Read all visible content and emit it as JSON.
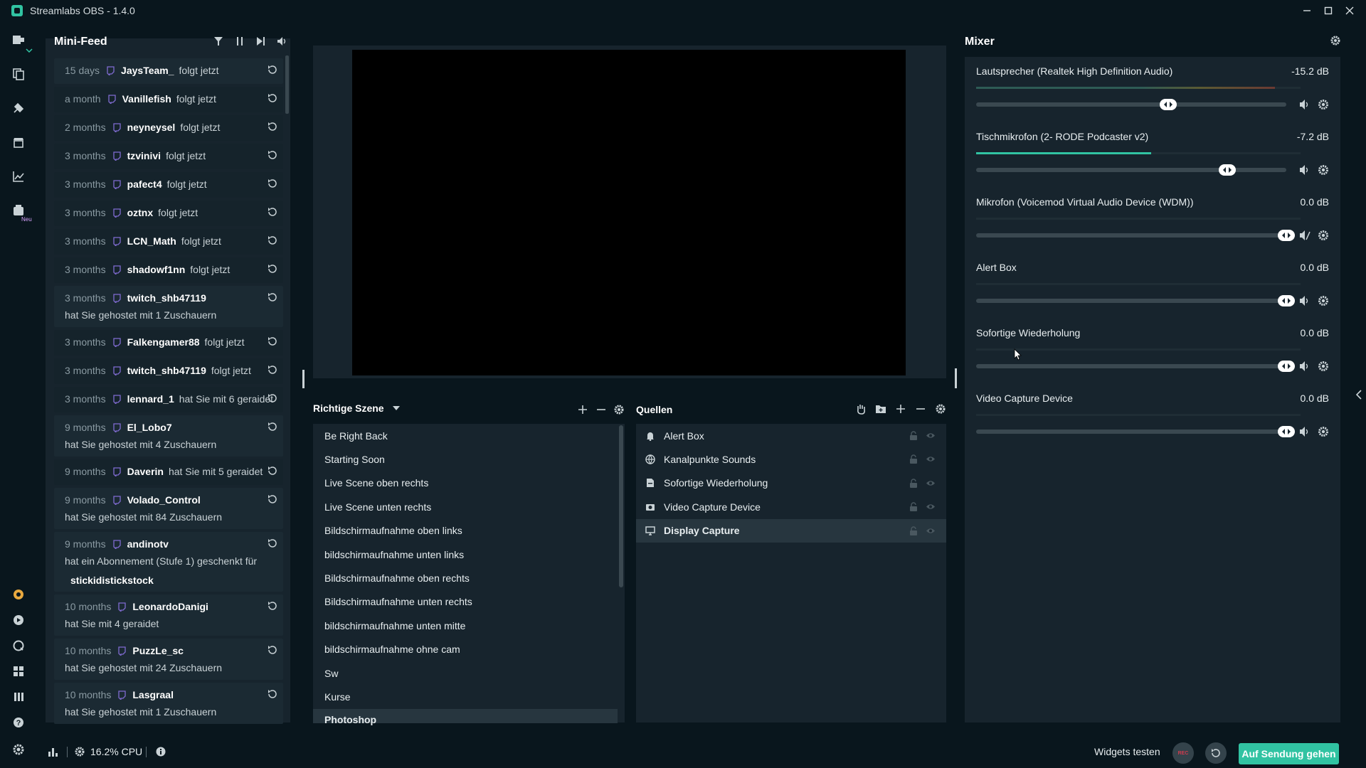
{
  "titlebar": {
    "title": "Streamlabs OBS - 1.4.0"
  },
  "leftnav": {
    "badge": "Neu"
  },
  "minifeed": {
    "title": "Mini-Feed",
    "items": [
      {
        "time": "15 days",
        "user": "JaysTeam_",
        "action": "folgt jetzt",
        "sub": "",
        "sub2": ""
      },
      {
        "time": "a month",
        "user": "Vanillefish",
        "action": "folgt jetzt",
        "sub": "",
        "sub2": ""
      },
      {
        "time": "2 months",
        "user": "neyneysel",
        "action": "folgt jetzt",
        "sub": "",
        "sub2": ""
      },
      {
        "time": "3 months",
        "user": "tzvinivi",
        "action": "folgt jetzt",
        "sub": "",
        "sub2": ""
      },
      {
        "time": "3 months",
        "user": "pafect4",
        "action": "folgt jetzt",
        "sub": "",
        "sub2": ""
      },
      {
        "time": "3 months",
        "user": "oztnx",
        "action": "folgt jetzt",
        "sub": "",
        "sub2": ""
      },
      {
        "time": "3 months",
        "user": "LCN_Math",
        "action": "folgt jetzt",
        "sub": "",
        "sub2": ""
      },
      {
        "time": "3 months",
        "user": "shadowf1nn",
        "action": "folgt jetzt",
        "sub": "",
        "sub2": ""
      },
      {
        "time": "3 months",
        "user": "twitch_shb47119",
        "action": "",
        "sub": "hat Sie gehostet mit 1 Zuschauern",
        "sub2": ""
      },
      {
        "time": "3 months",
        "user": "Falkengamer88",
        "action": "folgt jetzt",
        "sub": "",
        "sub2": ""
      },
      {
        "time": "3 months",
        "user": "twitch_shb47119",
        "action": "folgt jetzt",
        "sub": "",
        "sub2": ""
      },
      {
        "time": "3 months",
        "user": "lennard_1",
        "action": "hat Sie mit 6 geraidet",
        "sub": "",
        "sub2": ""
      },
      {
        "time": "9 months",
        "user": "El_Lobo7",
        "action": "",
        "sub": "hat Sie gehostet mit 4 Zuschauern",
        "sub2": ""
      },
      {
        "time": "9 months",
        "user": "Daverin",
        "action": "hat Sie mit 5 geraidet",
        "sub": "",
        "sub2": ""
      },
      {
        "time": "9 months",
        "user": "Volado_Control",
        "action": "",
        "sub": "hat Sie gehostet mit 84 Zuschauern",
        "sub2": ""
      },
      {
        "time": "9 months",
        "user": "andinotv",
        "action": "",
        "sub": "hat ein Abonnement (Stufe 1) geschenkt für",
        "sub2": "stickidistickstock"
      },
      {
        "time": "10 months",
        "user": "LeonardoDanigi",
        "action": "",
        "sub": "hat Sie mit 4 geraidet",
        "sub2": ""
      },
      {
        "time": "10 months",
        "user": "PuzzLe_sc",
        "action": "",
        "sub": "hat Sie gehostet mit 24 Zuschauern",
        "sub2": ""
      },
      {
        "time": "10 months",
        "user": "Lasgraal",
        "action": "",
        "sub": "hat Sie gehostet mit 1 Zuschauern",
        "sub2": ""
      }
    ]
  },
  "scenes": {
    "title": "Richtige Szene",
    "items": [
      "Be Right Back",
      "Starting Soon",
      "Live Scene oben rechts",
      "Live Scene unten rechts",
      "Bildschirmaufnahme oben links",
      "bildschirmaufnahme unten links",
      "Bildschirmaufnahme oben rechts",
      "Bildschirmaufnahme unten rechts",
      "bildschirmaufnahme unten mitte",
      "bildschirmaufnahme ohne cam",
      "Sw",
      "Kurse",
      "Photoshop"
    ],
    "selected": "Photoshop"
  },
  "sources": {
    "title": "Quellen",
    "items": [
      {
        "label": "Alert Box",
        "icon": "bell-icon"
      },
      {
        "label": "Kanalpunkte Sounds",
        "icon": "globe-icon"
      },
      {
        "label": "Sofortige Wiederholung",
        "icon": "file-icon"
      },
      {
        "label": "Video Capture Device",
        "icon": "camera-icon"
      },
      {
        "label": "Display Capture",
        "icon": "monitor-icon"
      }
    ],
    "selected": "Display Capture"
  },
  "mixer": {
    "title": "Mixer",
    "channels": [
      {
        "name": "Lautsprecher (Realtek High Definition Audio)",
        "db": "-15.2 dB",
        "level": 0.62,
        "meter": 0.92,
        "muted": false
      },
      {
        "name": "Tischmikrofon (2- RODE Podcaster v2)",
        "db": "-7.2 dB",
        "level": 0.81,
        "meter": 0.54,
        "muted": false
      },
      {
        "name": "Mikrofon (Voicemod Virtual Audio Device (WDM))",
        "db": "0.0 dB",
        "level": 1.0,
        "meter": 0,
        "muted": true
      },
      {
        "name": "Alert Box",
        "db": "0.0 dB",
        "level": 1.0,
        "meter": 0,
        "muted": false
      },
      {
        "name": "Sofortige Wiederholung",
        "db": "0.0 dB",
        "level": 1.0,
        "meter": 0,
        "muted": false
      },
      {
        "name": "Video Capture Device",
        "db": "0.0 dB",
        "level": 1.0,
        "meter": 0,
        "muted": false
      }
    ]
  },
  "statusbar": {
    "cpu": "16.2% CPU",
    "test_widgets": "Widgets testen",
    "rec": "REC",
    "go_live": "Auf Sendung gehen"
  },
  "colors": {
    "accent": "#31c3a2",
    "panel": "#17242d",
    "background": "#09161d",
    "rec": "#cf3c4f"
  }
}
